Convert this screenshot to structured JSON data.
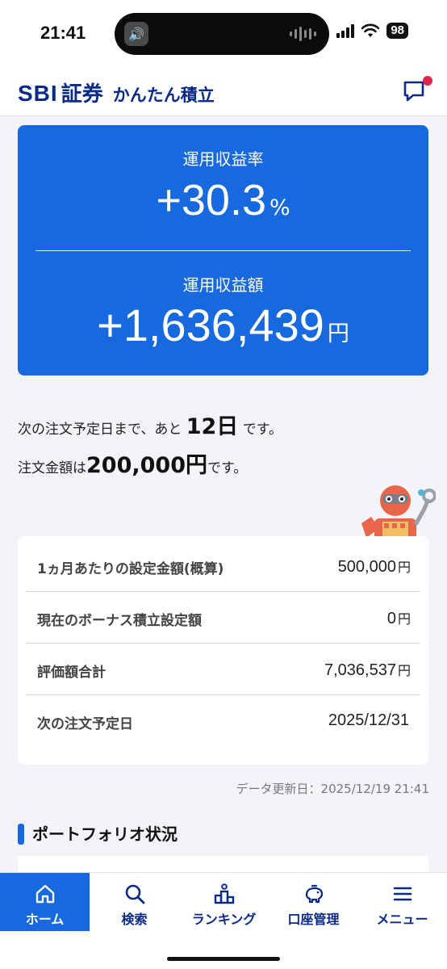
{
  "status_bar": {
    "time": "21:41",
    "battery": "98",
    "icons": [
      "speaker-icon",
      "waveform-icon",
      "signal-icon",
      "wifi-icon",
      "battery-icon"
    ]
  },
  "header": {
    "brand": "SBI",
    "brand_sec": "証券",
    "subtitle": "かんたん積立",
    "message_icon": "message-icon",
    "accent": "#0a2a8a",
    "badge_color": "#e0244f"
  },
  "profit_card": {
    "rate_label": "運用収益率",
    "rate_value": "+30.3",
    "rate_unit": "%",
    "amount_label": "運用収益額",
    "amount_value": "+1,636,439",
    "amount_unit": "円",
    "background": "#1769e0"
  },
  "order_info": {
    "line1_prefix": "次の注文予定日まで、あと",
    "days": "12日",
    "line1_suffix": "です。",
    "line2_prefix": "注文金額は",
    "amount": "200,000円",
    "line2_suffix": "です。"
  },
  "settings": [
    {
      "label": "1ヵ月あたりの設定金額(概算)",
      "value": "500,000",
      "unit": "円"
    },
    {
      "label": "現在のボーナス積立設定額",
      "value": "0",
      "unit": "円"
    },
    {
      "label": "評価額合計",
      "value": "7,036,537",
      "unit": "円"
    },
    {
      "label": "次の注文予定日",
      "value": "2025/12/31",
      "unit": ""
    }
  ],
  "update_time": "データ更新日：2025/12/19 21:41",
  "section": {
    "title": "ポートフォリオ状況"
  },
  "bottom_nav": {
    "items": [
      {
        "label": "ホーム",
        "icon": "home-icon",
        "active": true
      },
      {
        "label": "検索",
        "icon": "search-icon",
        "active": false
      },
      {
        "label": "ランキング",
        "icon": "ranking-icon",
        "active": false
      },
      {
        "label": "口座管理",
        "icon": "piggy-bank-icon",
        "active": false
      },
      {
        "label": "メニュー",
        "icon": "menu-icon",
        "active": false
      }
    ]
  }
}
